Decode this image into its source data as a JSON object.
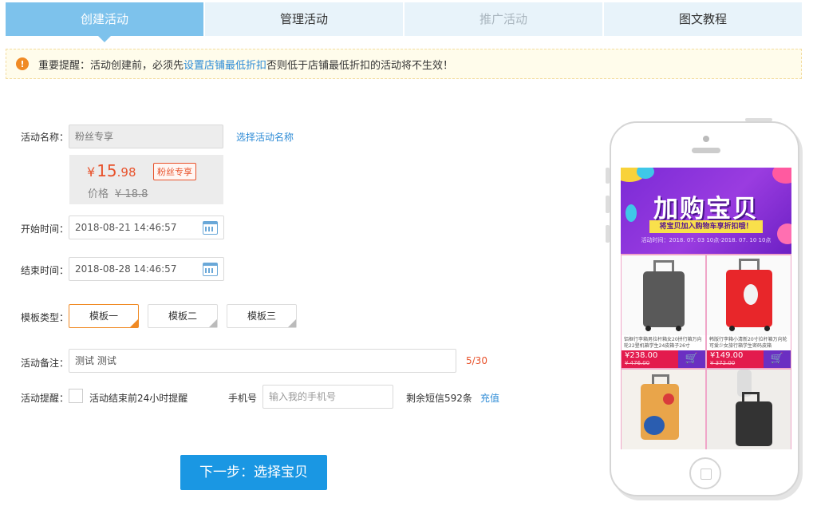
{
  "tabs": [
    {
      "label": "创建活动",
      "state": "active"
    },
    {
      "label": "管理活动",
      "state": "normal"
    },
    {
      "label": "推广活动",
      "state": "disabled"
    },
    {
      "label": "图文教程",
      "state": "normal"
    }
  ],
  "notice": {
    "icon": "warning-icon",
    "prefix": "重要提醒：活动创建前，必须先",
    "link": "设置店铺最低折扣",
    "suffix": "否则低于店铺最低折扣的活动将不生效！"
  },
  "form": {
    "name_label": "活动名称：",
    "name_value": "粉丝专享",
    "name_link": "选择活动名称",
    "price": {
      "currency": "¥",
      "int": "15",
      "dec": ".98",
      "tag": "粉丝专享",
      "old_label": "价格",
      "old_value": "¥ 18.8"
    },
    "start_label": "开始时间：",
    "start_value": "2018-08-21 14:46:57",
    "end_label": "结束时间：",
    "end_value": "2018-08-28 14:46:57",
    "template_label": "模板类型：",
    "templates": [
      "模板一",
      "模板二",
      "模板三"
    ],
    "selected_template": "模板一",
    "remark_label": "活动备注：",
    "remark_value": "测试 测试",
    "remark_counter": "5/30",
    "reminder_label": "活动提醒：",
    "reminder_checkbox": "活动结束前24小时提醒",
    "phone_label": "手机号",
    "phone_placeholder": "输入我的手机号",
    "sms_left": "剩余短信592条",
    "recharge": "充值",
    "next_button": "下一步：选择宝贝"
  },
  "preview": {
    "banner_title": "加购宝贝",
    "banner_sub": "将宝贝加入购物车享折扣哦！",
    "banner_date": "活动时间：2018. 07. 03  10点-2018. 07. 10  10点",
    "products": [
      {
        "desc": "铝框行李箱男拉杆箱女20拼行箱万向轮22登机箱学生24皮箱子26寸",
        "price": "¥238.00",
        "old": "¥ 476.00",
        "color": "#555555"
      },
      {
        "desc": "韩版行李箱小清新20寸拉杆箱万向轮可爱少女旅行箱学生密码皮箱",
        "price": "¥149.00",
        "old": "¥ 372.00",
        "color": "#e8262a"
      }
    ],
    "colors": {
      "banner": "#8a34dc",
      "accent_yellow": "#f9e04b",
      "price_bar": "#e31b4d",
      "cart": "#6b2fc2"
    }
  },
  "colors": {
    "tab_active": "#7dc2ec",
    "link": "#2d8bd6",
    "primary_button": "#1a97e3",
    "price": "#e8522b",
    "template_active": "#f08a24"
  }
}
